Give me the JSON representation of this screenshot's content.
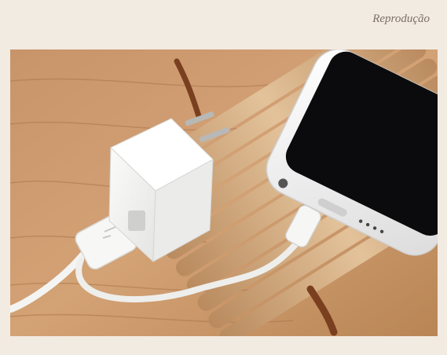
{
  "caption": {
    "credit": "Reprodução"
  },
  "photo": {
    "subject": "charger-and-phone",
    "colors": {
      "wood": "#c79a6a",
      "bamboo": "#d9b489",
      "plastic": "#f6f6f4",
      "phone": "#0b0b0d",
      "background": "#f2ebe2"
    }
  }
}
